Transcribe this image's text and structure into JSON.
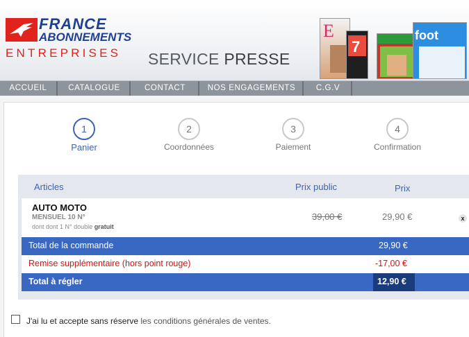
{
  "brand": {
    "line1": "FRANCE",
    "line2": "ABONNEMENTS",
    "line3": "ENTREPRISES",
    "service_a": "SERVICE",
    "service_b": "PRESSE"
  },
  "nav": [
    "ACCUEIL",
    "CATALOGUE",
    "CONTACT",
    "NOS ENGAGEMENTS",
    "C.G.V"
  ],
  "steps": [
    {
      "num": "1",
      "label": "Panier",
      "active": true
    },
    {
      "num": "2",
      "label": "Coordonnées",
      "active": false
    },
    {
      "num": "3",
      "label": "Paiement",
      "active": false
    },
    {
      "num": "4",
      "label": "Confirmation",
      "active": false
    }
  ],
  "table": {
    "col_article": "Articles",
    "col_public": "Prix public",
    "col_price": "Prix",
    "item": {
      "title": "AUTO MOTO",
      "subtitle": "MENSUEL 10 N°",
      "note_prefix": "dont dont 1 N° double",
      "note_bold": "gratuit",
      "public_price": "39,00 €",
      "price": "29,90 €",
      "remove": "x"
    },
    "total_label": "Total de la commande",
    "total_value": "29,90 €",
    "discount_label": "Remise supplémentaire (hors point rouge)",
    "discount_value": "-17,00 €",
    "grand_label": "Total à régler",
    "grand_value": "12,90 €"
  },
  "cgv": {
    "text": "J'ai lu et accepte sans réserve",
    "link": "les conditions générales de ventes."
  },
  "colors": {
    "accent": "#3d63b4",
    "band": "#3868c2",
    "red": "#cc1414",
    "logo_red": "#e0231c",
    "logo_blue": "#1f3f93"
  },
  "icons": [
    "logo-bird-icon",
    "remove-icon",
    "checkbox-icon"
  ]
}
